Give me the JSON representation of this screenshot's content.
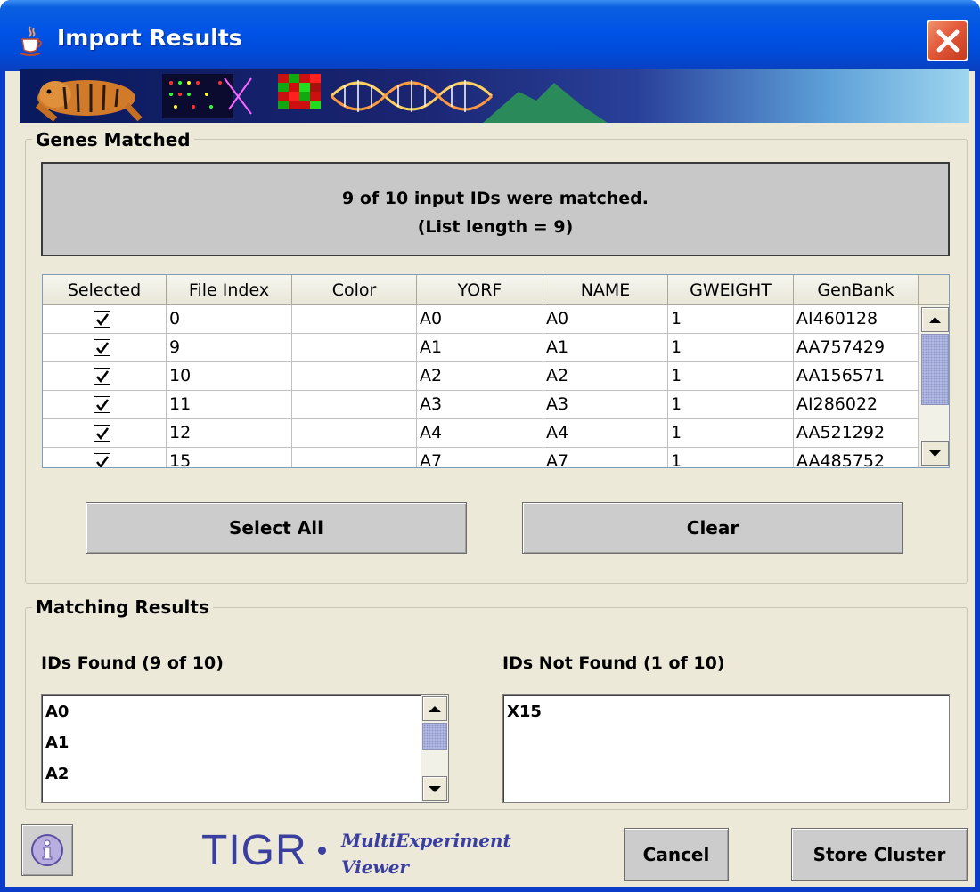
{
  "window": {
    "title": "Import Results",
    "colors": {
      "titlebar": "#0053e6",
      "client": "#ece9d8",
      "close": "#e3593a"
    }
  },
  "genes_matched": {
    "title": "Genes Matched",
    "message_line1": "9 of 10 input IDs were matched.",
    "message_line2": "(List length = 9)",
    "table": {
      "columns": [
        "Selected",
        "File Index",
        "Color",
        "YORF",
        "NAME",
        "GWEIGHT",
        "GenBank"
      ],
      "rows": [
        {
          "selected": true,
          "file_index": "0",
          "color": "",
          "yorf": "A0",
          "name": "A0",
          "gweight": "1",
          "genbank": "AI460128"
        },
        {
          "selected": true,
          "file_index": "9",
          "color": "",
          "yorf": "A1",
          "name": "A1",
          "gweight": "1",
          "genbank": "AA757429"
        },
        {
          "selected": true,
          "file_index": "10",
          "color": "",
          "yorf": "A2",
          "name": "A2",
          "gweight": "1",
          "genbank": "AA156571"
        },
        {
          "selected": true,
          "file_index": "11",
          "color": "",
          "yorf": "A3",
          "name": "A3",
          "gweight": "1",
          "genbank": "AI286022"
        },
        {
          "selected": true,
          "file_index": "12",
          "color": "",
          "yorf": "A4",
          "name": "A4",
          "gweight": "1",
          "genbank": "AA521292"
        },
        {
          "selected": true,
          "file_index": "15",
          "color": "",
          "yorf": "A7",
          "name": "A7",
          "gweight": "1",
          "genbank": "AA485752"
        }
      ]
    },
    "select_all_label": "Select All",
    "clear_label": "Clear"
  },
  "matching_results": {
    "title": "Matching Results",
    "found_label": "IDs Found (9 of 10)",
    "found_items": [
      "A0",
      "A1",
      "A2"
    ],
    "not_found_label": "IDs Not Found (1 of 10)",
    "not_found_items": [
      "X15"
    ]
  },
  "footer": {
    "info_icon": "info-icon",
    "logo_text": "TIGR",
    "logo_sub1": "MultiExperiment",
    "logo_sub2": "Viewer",
    "cancel_label": "Cancel",
    "store_label": "Store Cluster"
  }
}
